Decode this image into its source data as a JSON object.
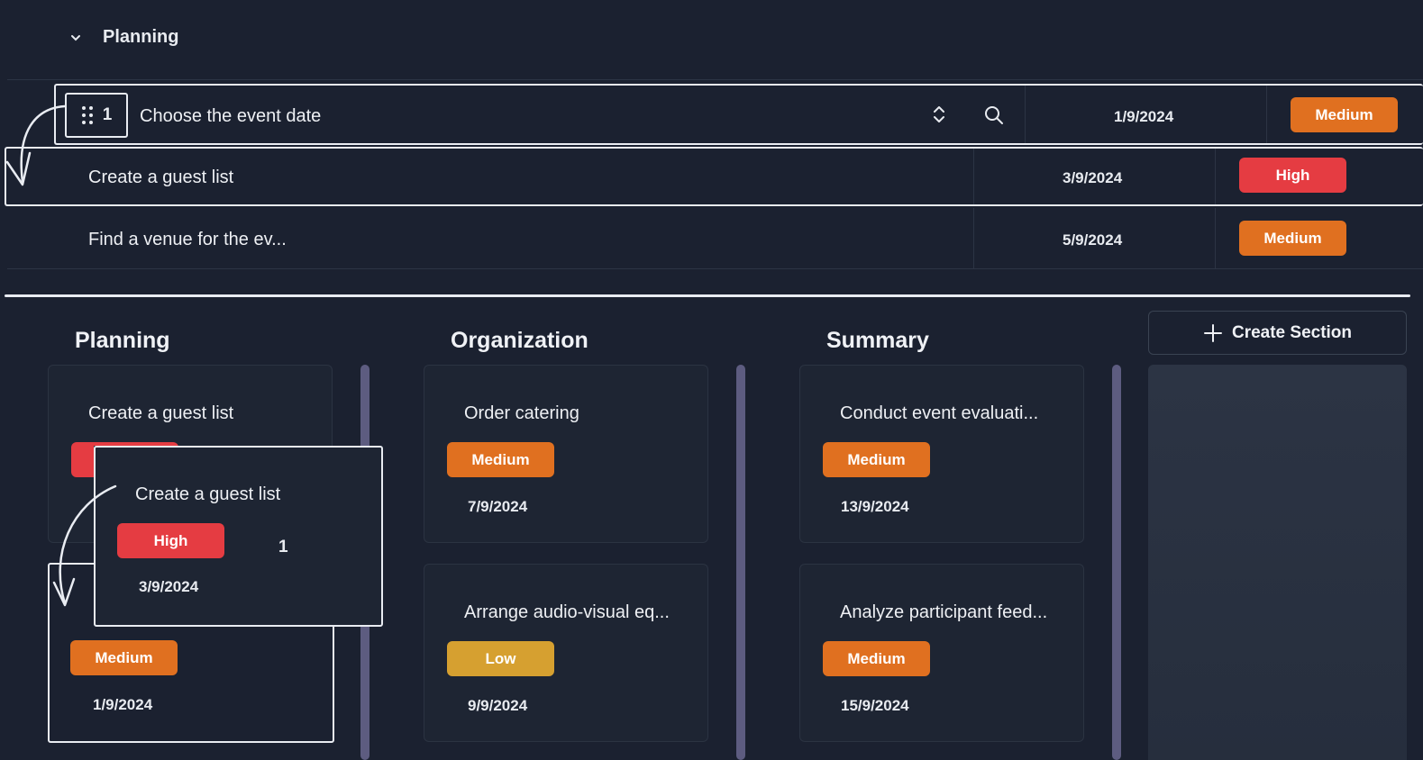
{
  "list": {
    "section_title": "Planning",
    "drag_row": {
      "handle_number": "1",
      "title": "Choose the event date",
      "date": "1/9/2024",
      "priority": "Medium"
    },
    "rows": [
      {
        "title": "Create a guest list",
        "date": "3/9/2024",
        "priority": "High"
      },
      {
        "title": "Find a venue for the ev...",
        "date": "5/9/2024",
        "priority": "Medium"
      }
    ]
  },
  "board": {
    "columns": [
      {
        "title": "Planning",
        "cards": [
          {
            "title": "Create a guest list",
            "priority": "High",
            "date": "3/9/2024"
          },
          {
            "priority": "Medium",
            "date": "1/9/2024"
          }
        ]
      },
      {
        "title": "Organization",
        "cards": [
          {
            "title": "Order catering",
            "priority": "Medium",
            "date": "7/9/2024"
          },
          {
            "title": "Arrange audio-visual eq...",
            "priority": "Low",
            "date": "9/9/2024"
          }
        ]
      },
      {
        "title": "Summary",
        "cards": [
          {
            "title": "Conduct event evaluati...",
            "priority": "Medium",
            "date": "13/9/2024"
          },
          {
            "title": "Analyze participant feed...",
            "priority": "Medium",
            "date": "15/9/2024"
          }
        ]
      }
    ],
    "create_section_label": "Create Section",
    "drag_card": {
      "title": "Create a guest list",
      "priority": "High",
      "date": "3/9/2024",
      "count": "1"
    }
  },
  "colors": {
    "background": "#1b2130",
    "medium": "#e07020",
    "high": "#e53c42",
    "low": "#d6a030",
    "scrollbar": "#5d5c80"
  }
}
